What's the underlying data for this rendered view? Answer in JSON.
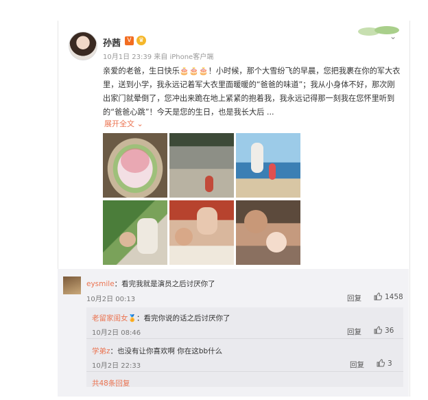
{
  "post": {
    "username": "孙茜",
    "badge": "V",
    "meta": "10月1日 23:39 来自 iPhone客户端",
    "text": "亲爱的老爸，生日快乐🎂🎂🎂！小时候，那个大雪纷飞的早晨，您把我裹在你的军大衣里，送到小学，我永远记着军大衣里面暖暖的“爸爸的味道”；我从小身体不好，那次刚出家门就晕倒了，您冲出来跪在地上紧紧的抱着我，我永远记得那一刻我在您怀里听到的“爸爸心跳”！今天是您的生日，也是我长大后 ...",
    "expand_label": "展开全文 ⌄",
    "photos": [
      "cake",
      "garden",
      "beach",
      "green",
      "stroller",
      "baby"
    ]
  },
  "comments": [
    {
      "user": "eysmile",
      "text": "：看完我就是演员之后讨厌你了",
      "time": "10月2日 00:13",
      "reply": "回复",
      "likes": "1458"
    }
  ],
  "subcomments": [
    {
      "user": "老留家闺女",
      "text": "：看完你说的话之后讨厌你了",
      "time": "10月2日 08:46",
      "reply": "回复",
      "likes": "36"
    },
    {
      "user": "学弟z",
      "text": "：也没有让你喜欢啊 你在这bb什么",
      "time": "10月2日 22:33",
      "reply": "回复",
      "likes": "3"
    }
  ],
  "more_replies": "共48条回复",
  "colors": {
    "accent": "#eb7350",
    "verified": "#f26d21"
  }
}
